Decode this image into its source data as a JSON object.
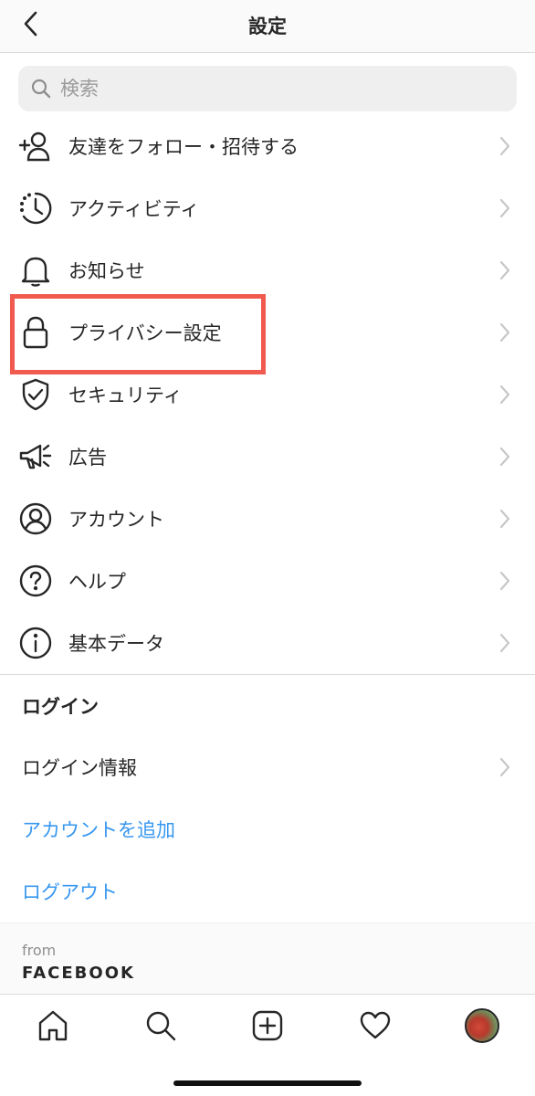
{
  "header": {
    "title": "設定"
  },
  "search": {
    "placeholder": "検索"
  },
  "menu": {
    "items": [
      {
        "label": "友達をフォロー・招待する",
        "icon": "add-person-icon"
      },
      {
        "label": "アクティビティ",
        "icon": "activity-clock-icon"
      },
      {
        "label": "お知らせ",
        "icon": "bell-icon"
      },
      {
        "label": "プライバシー設定",
        "icon": "lock-icon",
        "highlighted": true
      },
      {
        "label": "セキュリティ",
        "icon": "shield-check-icon"
      },
      {
        "label": "広告",
        "icon": "megaphone-icon"
      },
      {
        "label": "アカウント",
        "icon": "account-circle-icon"
      },
      {
        "label": "ヘルプ",
        "icon": "help-circle-icon"
      },
      {
        "label": "基本データ",
        "icon": "info-circle-icon"
      }
    ]
  },
  "login_section": {
    "title": "ログイン",
    "login_info": "ログイン情報",
    "add_account": "アカウントを追加",
    "logout": "ログアウト"
  },
  "footer": {
    "from": "from",
    "brand": "FACEBOOK"
  },
  "tabbar": {
    "tabs": [
      "home-icon",
      "search-icon",
      "new-post-icon",
      "heart-icon",
      "profile-avatar"
    ]
  },
  "colors": {
    "link_blue": "#3897f0",
    "highlight_red": "#f05a4f",
    "text": "#262626",
    "divider": "#dbdbdb"
  }
}
